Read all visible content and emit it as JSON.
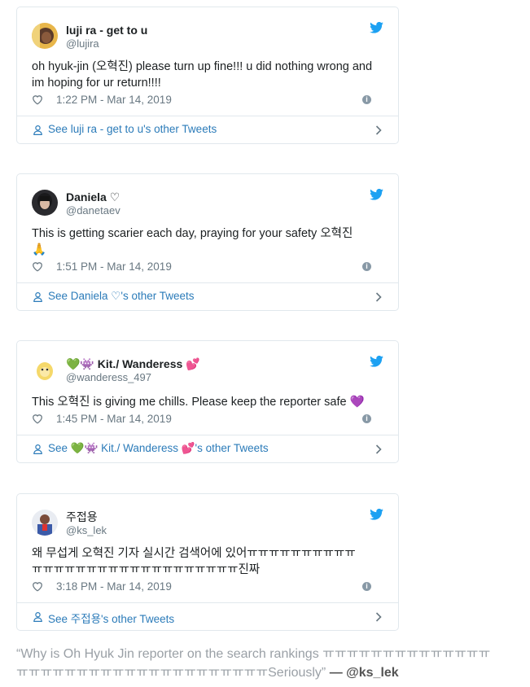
{
  "tweets": [
    {
      "display_name": "luji ra - get to u",
      "handle": "@lujira",
      "text_1": "oh hyuk-jin (오혁진) please turn up fine!!! u did nothing wrong and",
      "text_2": "im hoping for ur return!!!!",
      "timestamp": "1:22 PM - Mar 14, 2019",
      "see_prefix": "See ",
      "see_name": "luji ra - get to u",
      "see_suffix": "'s other Tweets"
    },
    {
      "display_name": "Daniela ♡",
      "handle": "@danetaev",
      "text_1": "This is getting scarier each day, praying for your safety 오혁진",
      "text_2": "🙏",
      "timestamp": "1:51 PM - Mar 14, 2019",
      "see_prefix": "See ",
      "see_name": "Daniela ♡",
      "see_suffix": "'s other Tweets"
    },
    {
      "display_name_emoji_1": "💚👾",
      "display_name": "Kit./ Wanderess",
      "display_name_emoji_2": "💕",
      "handle": "@wanderess_497",
      "text_1": "This 오혁진 is giving me chills. Please keep the reporter safe 💜",
      "timestamp": "1:45 PM - Mar 14, 2019",
      "see_prefix": "See ",
      "see_name_emoji_1": "💚👾",
      "see_name": "Kit./ Wanderess",
      "see_name_emoji_2": "💕",
      "see_suffix": "'s other Tweets"
    },
    {
      "display_name": "주접용",
      "handle": "@ks_lek",
      "text_1": "왜 무섭게 오혁진 기자 실시간 검색어에 있어ㅠㅠㅠㅠㅠㅠㅠㅠㅠㅠ",
      "text_2": "ㅠㅠㅠㅠㅠㅠㅠㅠㅠㅠㅠㅠㅠㅠㅠㅠㅠㅠㅠ진짜",
      "timestamp": "3:18 PM - Mar 14, 2019",
      "see_prefix": "See ",
      "see_name": "주접용",
      "see_suffix": "'s other Tweets"
    }
  ],
  "caption": {
    "quote_1": "“Why is Oh Hyuk Jin reporter on the search rankings ㅠㅠㅠㅠㅠㅠㅠㅠㅠㅠㅠㅠㅠㅠ",
    "quote_2": "ㅠㅠㅠㅠㅠㅠㅠㅠㅠㅠㅠㅠㅠㅠㅠㅠㅠㅠㅠㅠㅠSeriously”",
    "separator": " — ",
    "author": "@ks_lek"
  },
  "colors": {
    "link": "#2b7bb9",
    "twitter_blue": "#1da1f2",
    "meta_gray": "#697882",
    "border": "#e1e8ed"
  },
  "icons": [
    "twitter-bird-icon",
    "heart-icon",
    "info-icon",
    "person-icon",
    "chevron-right-icon"
  ]
}
